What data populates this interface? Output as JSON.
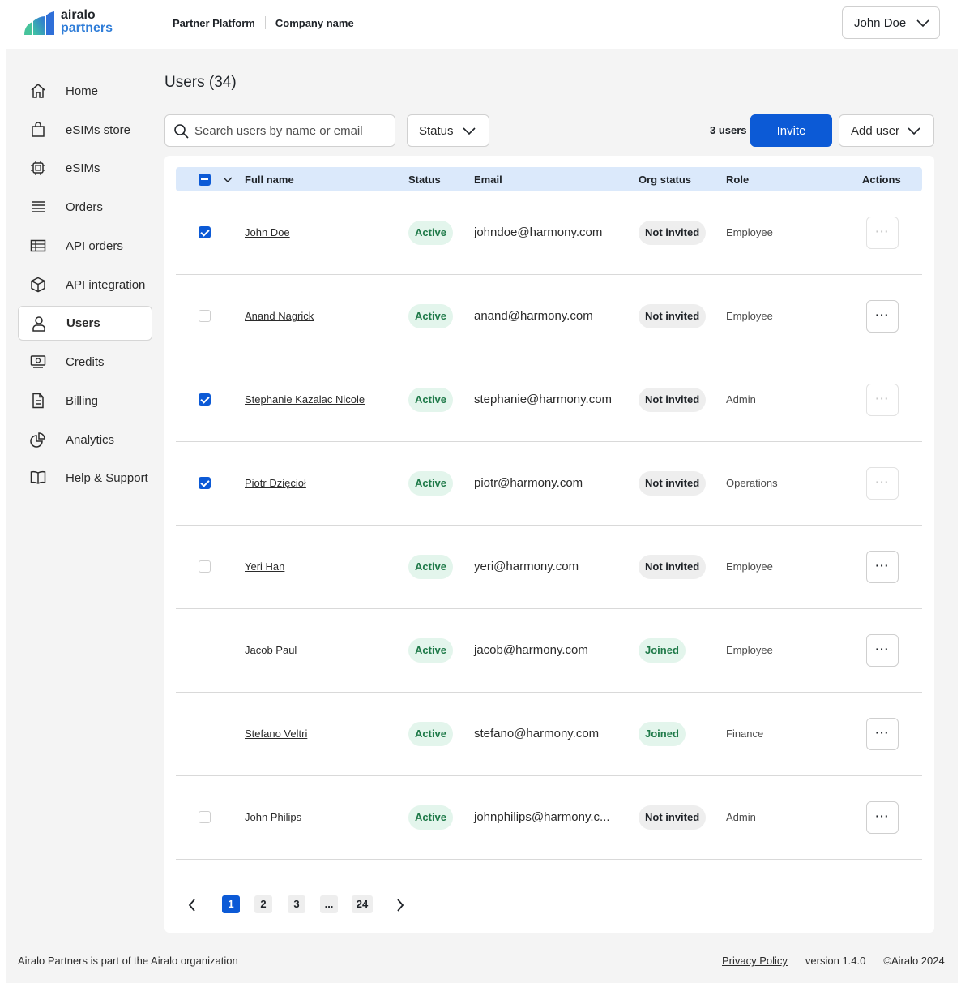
{
  "header": {
    "logo_line1": "airalo",
    "logo_line2": "partners",
    "breadcrumb_platform": "Partner Platform",
    "breadcrumb_company": "Company name",
    "user_name": "John Doe"
  },
  "sidebar": {
    "items": [
      {
        "label": "Home",
        "icon": "home-icon"
      },
      {
        "label": "eSIMs store",
        "icon": "shopping-bag-icon"
      },
      {
        "label": "eSIMs",
        "icon": "chip-icon"
      },
      {
        "label": "Orders",
        "icon": "list-icon"
      },
      {
        "label": "API orders",
        "icon": "table-icon"
      },
      {
        "label": "API integration",
        "icon": "cube-icon"
      },
      {
        "label": "Users",
        "icon": "user-icon",
        "active": true
      },
      {
        "label": "Credits",
        "icon": "money-icon"
      },
      {
        "label": "Billing",
        "icon": "document-icon"
      },
      {
        "label": "Analytics",
        "icon": "pie-chart-icon"
      },
      {
        "label": "Help & Support",
        "icon": "book-icon"
      }
    ]
  },
  "main": {
    "title": "Users (34)",
    "search_placeholder": "Search users by name or email",
    "status_filter_label": "Status",
    "selected_count": "3 users",
    "invite_label": "Invite",
    "add_user_label": "Add user"
  },
  "table": {
    "columns": {
      "full_name": "Full name",
      "status": "Status",
      "email": "Email",
      "org_status": "Org status",
      "role": "Role",
      "actions": "Actions"
    },
    "rows": [
      {
        "name": "John Doe",
        "status": "Active",
        "email": "johndoe@harmony.com",
        "org_status": "Not invited",
        "role": "Employee",
        "checkbox": "checked",
        "actions_enabled": false
      },
      {
        "name": "Anand Nagrick",
        "status": "Active",
        "email": "anand@harmony.com",
        "org_status": "Not invited",
        "role": "Employee",
        "checkbox": "unchecked",
        "actions_enabled": true
      },
      {
        "name": "Stephanie Kazalac Nicole",
        "status": "Active",
        "email": "stephanie@harmony.com",
        "org_status": "Not invited",
        "role": "Admin",
        "checkbox": "checked",
        "actions_enabled": false
      },
      {
        "name": "Piotr Dzięcioł",
        "status": "Active",
        "email": "piotr@harmony.com",
        "org_status": "Not invited",
        "role": "Operations",
        "checkbox": "checked",
        "actions_enabled": false
      },
      {
        "name": "Yeri Han",
        "status": "Active",
        "email": "yeri@harmony.com",
        "org_status": "Not invited",
        "role": "Employee",
        "checkbox": "unchecked",
        "actions_enabled": true
      },
      {
        "name": "Jacob Paul",
        "status": "Active",
        "email": "jacob@harmony.com",
        "org_status": "Joined",
        "role": "Employee",
        "checkbox": "none",
        "actions_enabled": true
      },
      {
        "name": "Stefano Veltri",
        "status": "Active",
        "email": "stefano@harmony.com",
        "org_status": "Joined",
        "role": "Finance",
        "checkbox": "none",
        "actions_enabled": true
      },
      {
        "name": "John Philips",
        "status": "Active",
        "email": "johnphilips@harmony.c...",
        "org_status": "Not invited",
        "role": "Admin",
        "checkbox": "unchecked",
        "actions_enabled": true
      }
    ],
    "actions_glyph": "···"
  },
  "pagination": {
    "pages": [
      "1",
      "2",
      "3",
      "...",
      "24"
    ],
    "current": "1"
  },
  "footer": {
    "left": "Airalo Partners is part of the Airalo organization",
    "privacy": "Privacy Policy",
    "version": "version 1.4.0",
    "copyright": "©Airalo 2024"
  },
  "colors": {
    "accent": "#0c5ad6",
    "header_row": "#dbe9fb",
    "active_pill_bg": "#e3f5ec",
    "active_pill_text": "#1f7a49",
    "background": "#f4f4f4"
  }
}
